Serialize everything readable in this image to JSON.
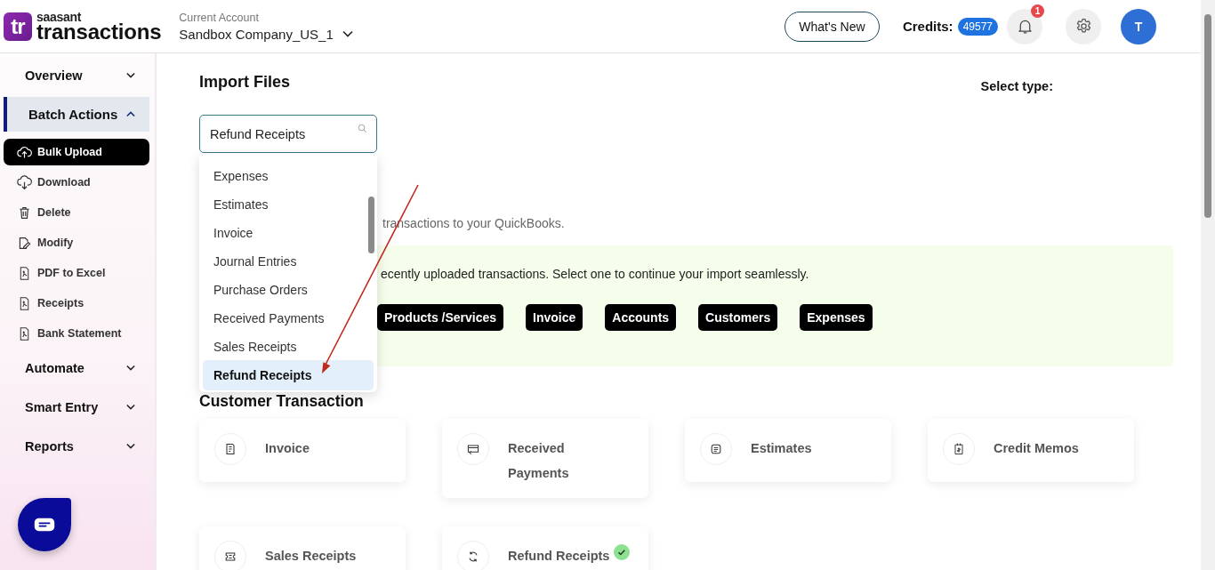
{
  "header": {
    "logo": {
      "brand": "saasant",
      "product": "transactions",
      "mark": "tr"
    },
    "account": {
      "label": "Current Account",
      "name": "Sandbox Company_US_1"
    },
    "whats_new": "What's New",
    "credits": {
      "label": "Credits:",
      "value": "49577"
    },
    "notifications": {
      "count": "1"
    },
    "avatar": "T"
  },
  "sidebar": {
    "items": [
      {
        "label": "Overview",
        "expanded": false
      },
      {
        "label": "Batch Actions",
        "expanded": true,
        "children": [
          {
            "label": "Bulk Upload",
            "selected": true
          },
          {
            "label": "Download",
            "selected": false
          },
          {
            "label": "Delete",
            "selected": false
          },
          {
            "label": "Modify",
            "selected": false
          },
          {
            "label": "PDF to Excel",
            "selected": false
          },
          {
            "label": "Receipts",
            "selected": false
          },
          {
            "label": "Bank Statement",
            "selected": false
          }
        ]
      },
      {
        "label": "Automate",
        "expanded": false
      },
      {
        "label": "Smart Entry",
        "expanded": false
      },
      {
        "label": "Reports",
        "expanded": false
      }
    ]
  },
  "main": {
    "title": "Import Files",
    "select_type_label": "Select type:",
    "search": {
      "value": "Refund Receipts"
    },
    "dropdown": {
      "options": [
        {
          "label": "Expenses",
          "selected": false
        },
        {
          "label": "Estimates",
          "selected": false
        },
        {
          "label": "Invoice",
          "selected": false
        },
        {
          "label": "Journal Entries",
          "selected": false
        },
        {
          "label": "Purchase Orders",
          "selected": false
        },
        {
          "label": "Received Payments",
          "selected": false
        },
        {
          "label": "Sales Receipts",
          "selected": false
        },
        {
          "label": "Refund Receipts",
          "selected": true
        }
      ]
    },
    "partial_line": "transactions to your QuickBooks.",
    "recent": {
      "text": "ecently uploaded transactions. Select one to continue your import seamlessly.",
      "chips": [
        "Products /Services",
        "Invoice",
        "Accounts",
        "Customers",
        "Expenses"
      ]
    },
    "section_title": "Customer Transaction",
    "cards": [
      {
        "label": "Invoice",
        "completed": false
      },
      {
        "label": "Received Payments",
        "completed": false
      },
      {
        "label": "Estimates",
        "completed": false
      },
      {
        "label": "Credit Memos",
        "completed": false
      },
      {
        "label": "Sales Receipts",
        "completed": false
      },
      {
        "label": "Refund Receipts",
        "completed": true
      }
    ]
  }
}
